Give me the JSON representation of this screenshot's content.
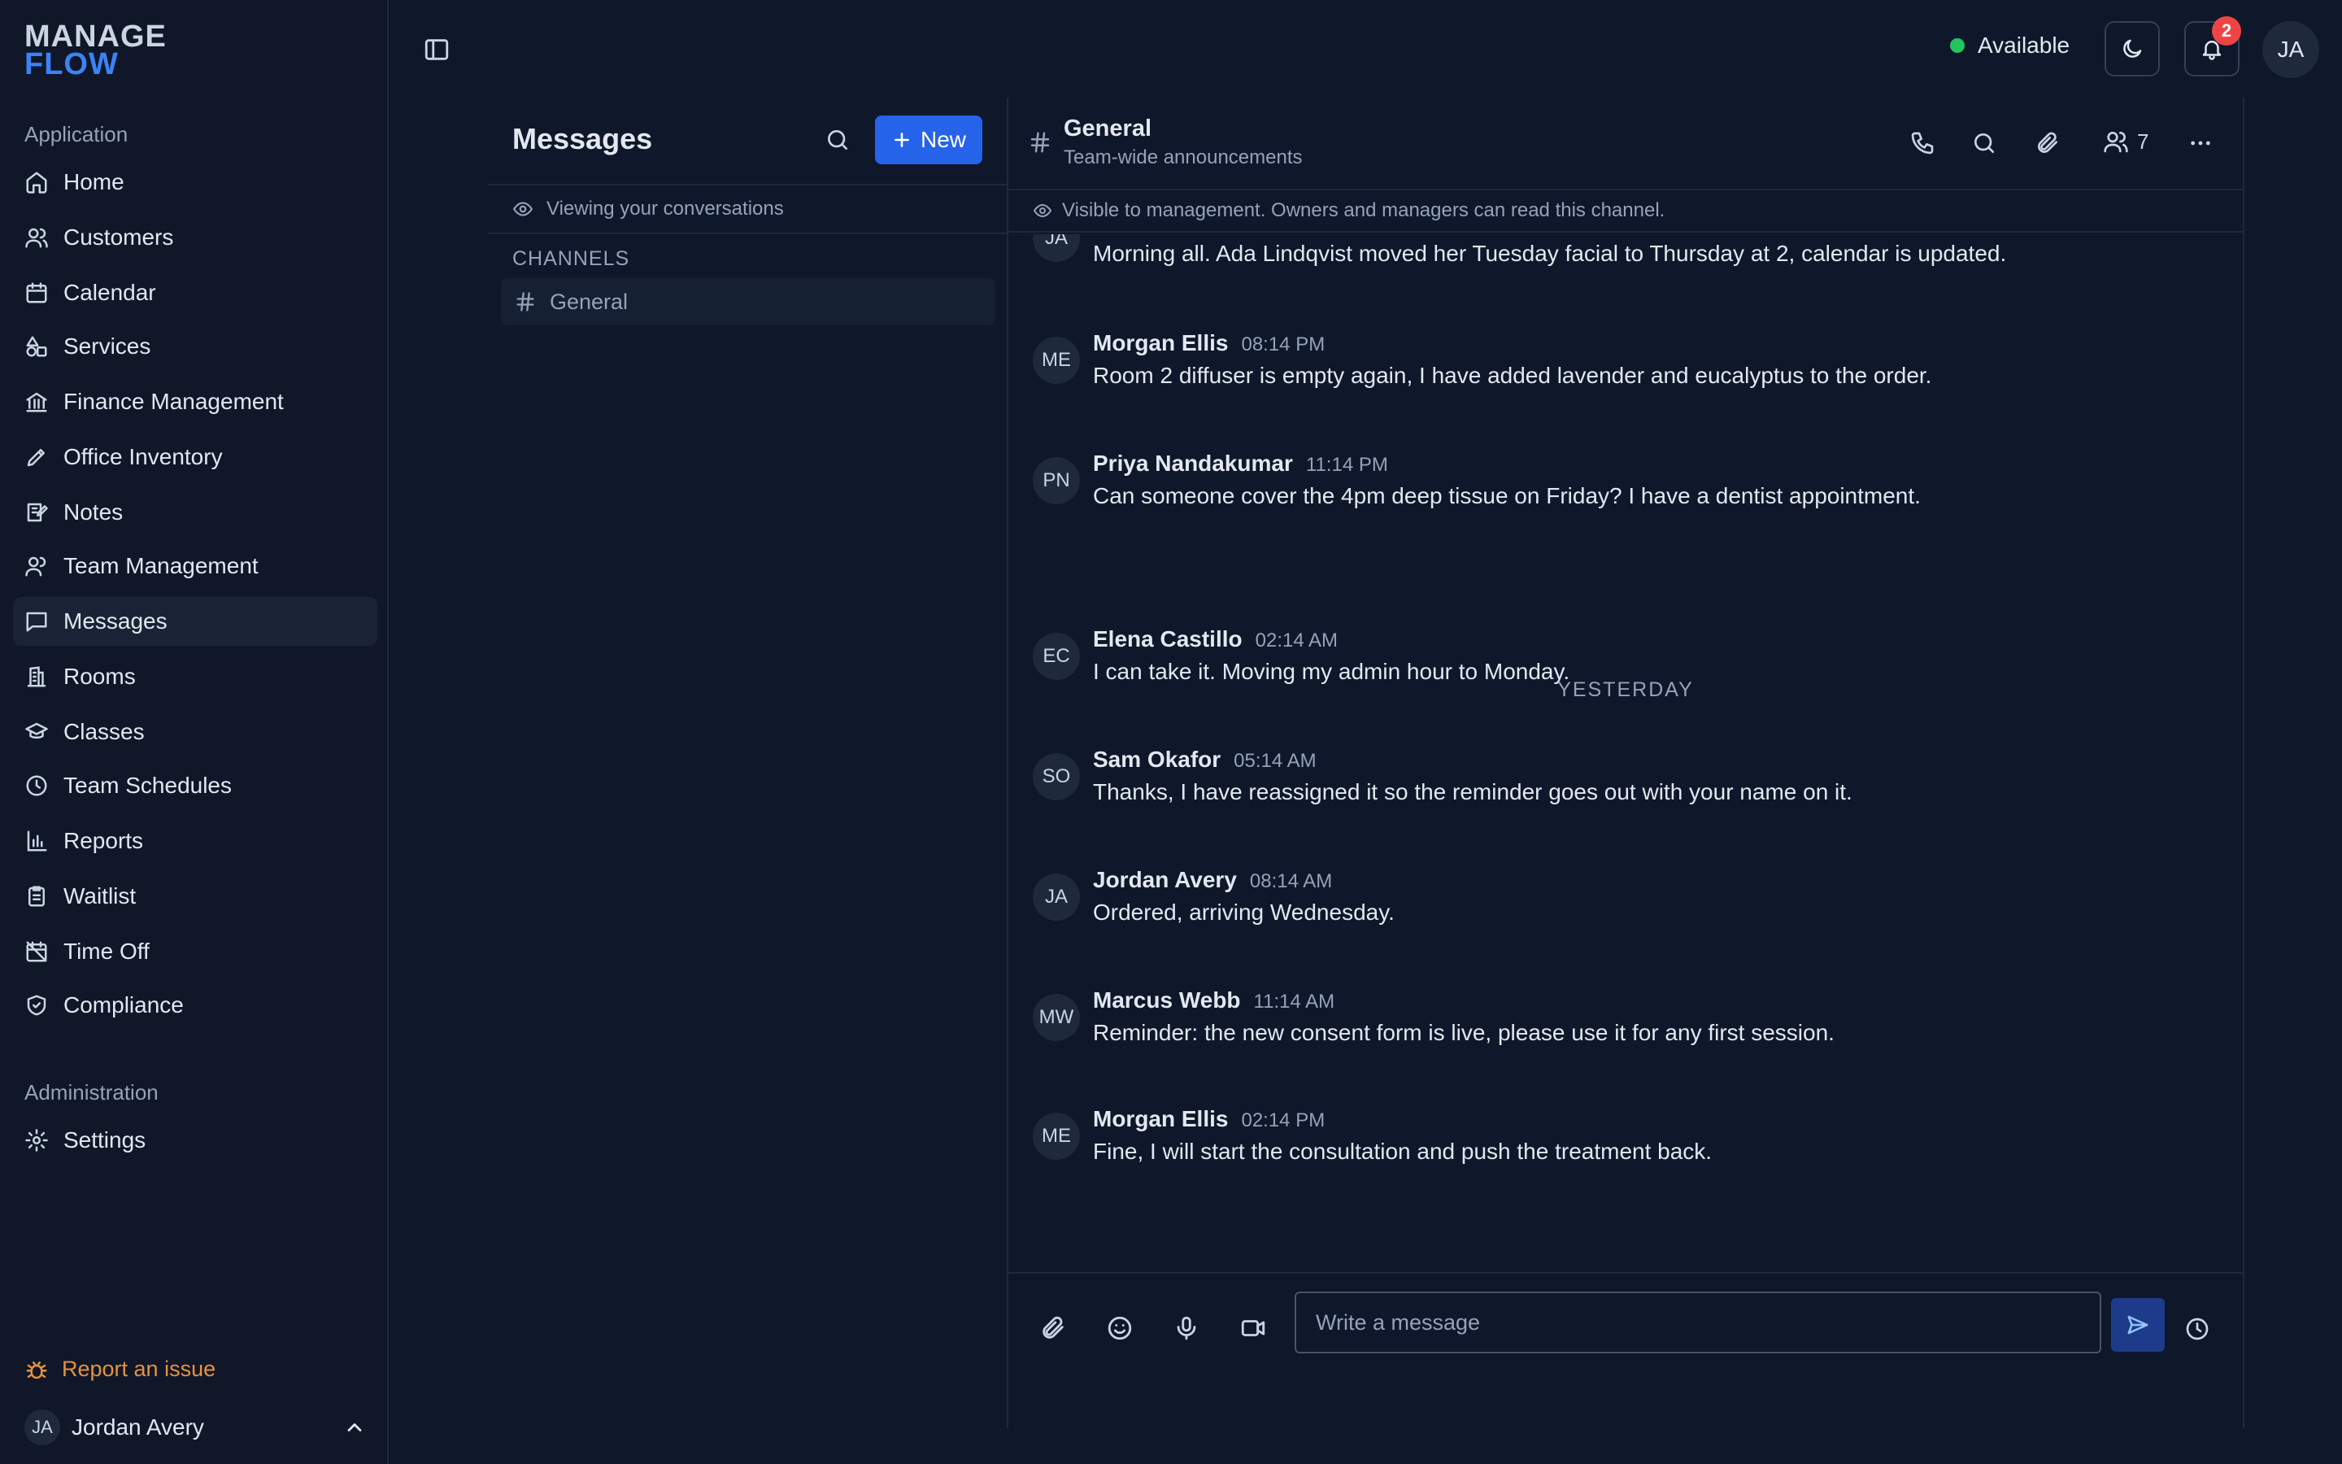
{
  "app": {
    "logo_line1": "MANAGE",
    "logo_line2": "FLOW",
    "accent_color": "#3b82f6"
  },
  "sidebar": {
    "section_application": "Application",
    "items": [
      {
        "label": "Home",
        "icon": "home-icon"
      },
      {
        "label": "Customers",
        "icon": "users-icon"
      },
      {
        "label": "Calendar",
        "icon": "calendar-icon"
      },
      {
        "label": "Services",
        "icon": "shapes-icon"
      },
      {
        "label": "Finance Management",
        "icon": "bank-icon"
      },
      {
        "label": "Office Inventory",
        "icon": "pen-icon"
      },
      {
        "label": "Notes",
        "icon": "notes-icon"
      },
      {
        "label": "Team Management",
        "icon": "team-icon"
      },
      {
        "label": "Messages",
        "icon": "message-icon",
        "active": true
      },
      {
        "label": "Rooms",
        "icon": "building-icon"
      },
      {
        "label": "Classes",
        "icon": "graduation-cap-icon"
      },
      {
        "label": "Team Schedules",
        "icon": "clock-icon"
      },
      {
        "label": "Reports",
        "icon": "bar-chart-icon"
      },
      {
        "label": "Waitlist",
        "icon": "clipboard-icon"
      },
      {
        "label": "Time Off",
        "icon": "calendar-off-icon"
      },
      {
        "label": "Compliance",
        "icon": "shield-check-icon"
      }
    ],
    "section_administration": "Administration",
    "admin_items": [
      {
        "label": "Settings",
        "icon": "gear-icon"
      }
    ],
    "report_issue": "Report an issue",
    "user_initials": "JA",
    "user_name": "Jordan Avery"
  },
  "topbar": {
    "status_label": "Available",
    "status_color": "#22c55e",
    "notification_count": "2",
    "avatar_initials": "JA"
  },
  "conversations": {
    "title": "Messages",
    "new_label": "New",
    "viewing_label": "Viewing your conversations",
    "channels_label": "CHANNELS",
    "channels": [
      {
        "name": "General"
      }
    ]
  },
  "chat": {
    "channel_name": "General",
    "channel_description": "Team-wide announcements",
    "member_count": "7",
    "visibility_notice": "Visible to management. Owners and managers can read this channel.",
    "messages": [
      {
        "initials": "JA",
        "author": "",
        "time": "",
        "text": "Morning all. Ada Lindqvist moved her Tuesday facial to Thursday at 2, calendar is updated."
      },
      {
        "initials": "ME",
        "author": "Morgan Ellis",
        "time": "08:14 PM",
        "text": "Room 2 diffuser is empty again, I have added lavender and eucalyptus to the order."
      },
      {
        "initials": "PN",
        "author": "Priya Nandakumar",
        "time": "11:14 PM",
        "text": "Can someone cover the 4pm deep tissue on Friday? I have a dentist appointment."
      },
      {
        "initials": "EC",
        "author": "Elena Castillo",
        "time": "02:14 AM",
        "text": "I can take it. Moving my admin hour to Monday."
      },
      {
        "initials": "SO",
        "author": "Sam Okafor",
        "time": "05:14 AM",
        "text": "Thanks, I have reassigned it so the reminder goes out with your name on it."
      },
      {
        "initials": "JA",
        "author": "Jordan Avery",
        "time": "08:14 AM",
        "text": "Ordered, arriving Wednesday."
      },
      {
        "initials": "MW",
        "author": "Marcus Webb",
        "time": "11:14 AM",
        "text": "Reminder: the new consent form is live, please use it for any first session."
      },
      {
        "initials": "ME",
        "author": "Morgan Ellis",
        "time": "02:14 PM",
        "text": "Fine, I will start the consultation and push the treatment back."
      }
    ],
    "day_divider": "YESTERDAY",
    "composer_placeholder": "Write a message"
  }
}
